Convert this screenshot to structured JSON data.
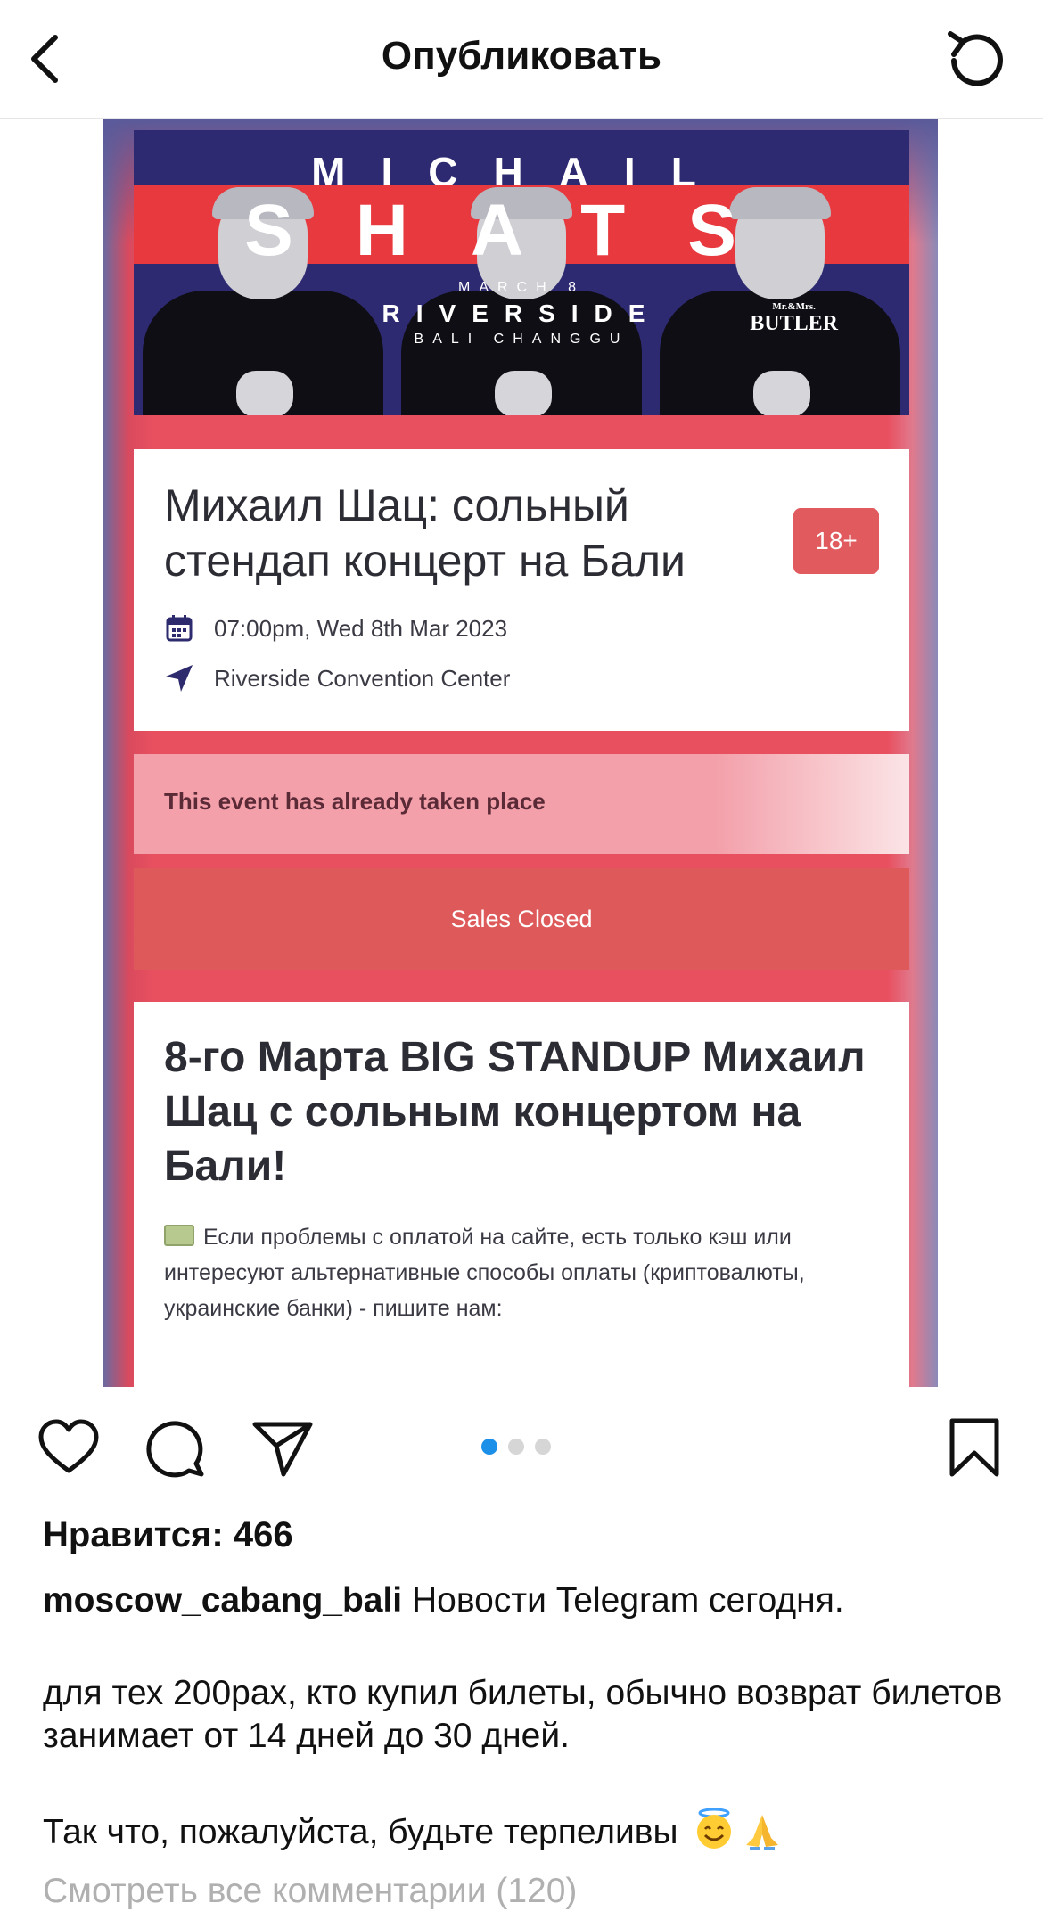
{
  "header": {
    "title": "Опубликовать",
    "back_icon": "chevron-left-icon",
    "refresh_icon": "rotate-ccw-icon"
  },
  "post_image": {
    "banner": {
      "line1": "MICHAIL",
      "line2": "SHATS",
      "date": "MARCH 8",
      "venue": "RIVERSIDE",
      "location": "BALI CHANGGU",
      "sponsor_small": "Mr.&Mrs.",
      "sponsor": "BUTLER"
    },
    "event": {
      "title": "Михаил Шац: сольный стендап концерт на Бали",
      "age_badge": "18+",
      "datetime": "07:00pm, Wed 8th Mar 2023",
      "venue": "Riverside Convention Center",
      "calendar_icon": "calendar-icon",
      "location_icon": "navigation-arrow-icon"
    },
    "notice": "This event has already taken place",
    "sales_button": "Sales Closed",
    "description": {
      "heading": "8-го Марта BIG STANDUP Михаил Шац с сольным концертом на Бали!",
      "text": "Если проблемы с оплатой на сайте, есть только кэш или интересуют альтернативные способы оплаты (криптовалюты, украинские банки) - пишите нам:"
    },
    "accent_color": "#e8505f"
  },
  "actions": {
    "like_icon": "heart-icon",
    "comment_icon": "comment-icon",
    "share_icon": "paper-plane-icon",
    "save_icon": "bookmark-icon",
    "carousel_pages": 3,
    "carousel_active": 1
  },
  "likes": "Нравится: 466",
  "caption": {
    "username": "moscow_cabang_bali",
    "line1": "Новости Telegram сегодня.",
    "line2": "для тех 200рах, кто купил билеты, обычно возврат билетов занимает от 14 дней до 30 дней.",
    "line3": "Так что, пожалуйста, будьте терпеливы",
    "emojis": [
      "smiling-face-with-halo-emoji",
      "folded-hands-emoji"
    ]
  },
  "comments_link": "Смотреть все комментарии (120)"
}
